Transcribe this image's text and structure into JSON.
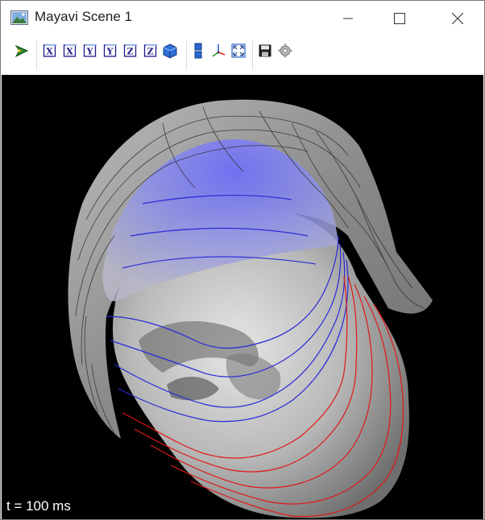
{
  "window": {
    "title": "Mayavi Scene 1",
    "controls": [
      "minimize",
      "maximize",
      "close"
    ]
  },
  "toolbar": {
    "groups": [
      [
        "mayavi-logo-icon"
      ],
      [
        "view-x-minus-icon",
        "view-x-plus-icon",
        "view-y-minus-icon",
        "view-y-plus-icon",
        "view-z-minus-icon",
        "view-z-plus-icon",
        "isometric-view-icon"
      ],
      [
        "parallel-projection-icon",
        "axes-toggle-icon",
        "fullscreen-icon"
      ],
      [
        "save-icon",
        "settings-icon"
      ]
    ],
    "axis_letters": [
      "X",
      "X",
      "Y",
      "Y",
      "Z",
      "Z"
    ]
  },
  "scene": {
    "time_label": "t = 100 ms",
    "colors": {
      "background": "#000000",
      "head": "#c8c8c8",
      "helmet": "#9a9a9a",
      "cap": "#7a7ff0",
      "contour_blue": "#2a2ad8",
      "contour_red": "#e01818",
      "contour_gray": "#2b2b2b"
    }
  }
}
